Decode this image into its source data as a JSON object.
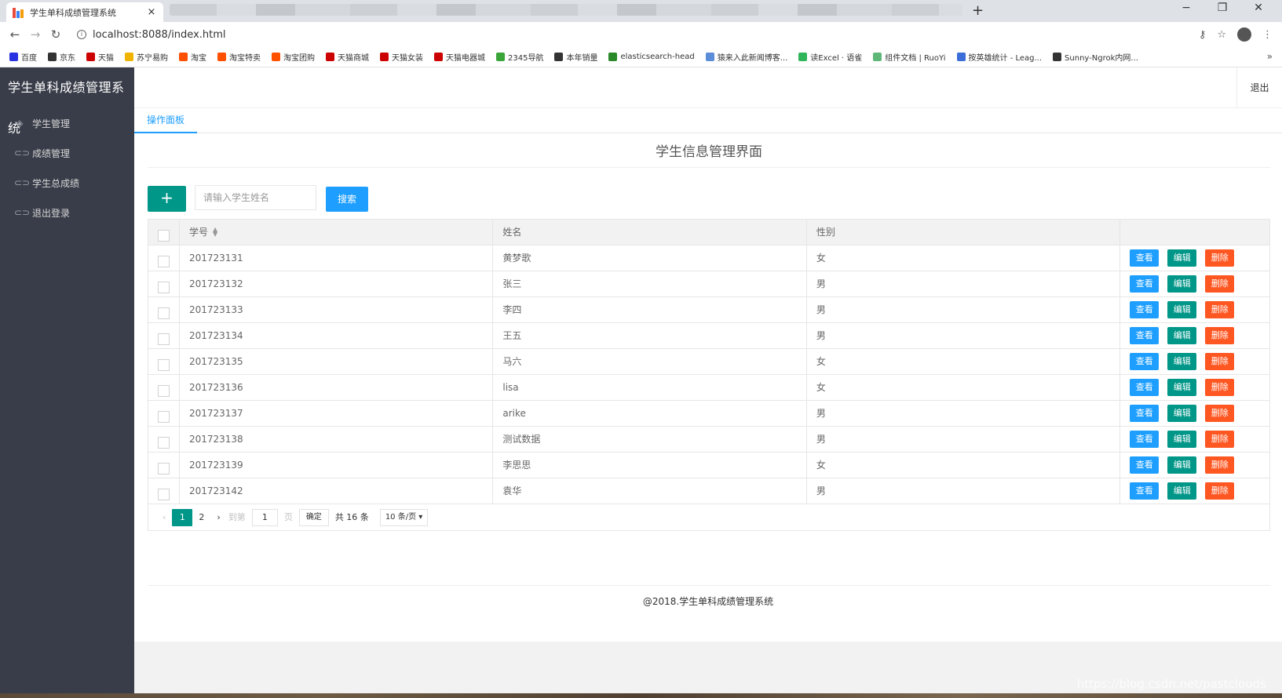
{
  "browser": {
    "tab_title": "学生单科成绩管理系统",
    "tab_close": "×",
    "new_tab": "+",
    "url": "localhost:8088/index.html",
    "window_controls": [
      "−",
      "❐",
      "✕"
    ],
    "bookmarks": [
      {
        "label": "百度",
        "color": "#2932e1"
      },
      {
        "label": "京东",
        "color": "#333333"
      },
      {
        "label": "天猫",
        "color": "#cc0000"
      },
      {
        "label": "苏宁易购",
        "color": "#f0b400"
      },
      {
        "label": "淘宝",
        "color": "#ff5000"
      },
      {
        "label": "淘宝特卖",
        "color": "#ff5000"
      },
      {
        "label": "淘宝团购",
        "color": "#ff5000"
      },
      {
        "label": "天猫商城",
        "color": "#cc0000"
      },
      {
        "label": "天猫女装",
        "color": "#cc0000"
      },
      {
        "label": "天猫电器城",
        "color": "#cc0000"
      },
      {
        "label": "2345导航",
        "color": "#3aa63a"
      },
      {
        "label": "本年销量",
        "color": "#333333"
      },
      {
        "label": "elasticsearch-head",
        "color": "#2a8a2a"
      },
      {
        "label": "猿来入此新闻博客...",
        "color": "#5b8dd9"
      },
      {
        "label": "读Excel · 语雀",
        "color": "#31b55b"
      },
      {
        "label": "组件文档 | RuoYi",
        "color": "#5fb878"
      },
      {
        "label": "按英雄统计 - Leag...",
        "color": "#3b6ed8"
      },
      {
        "label": "Sunny-Ngrok内网...",
        "color": "#333333"
      }
    ],
    "bookmarks_more": "»"
  },
  "app": {
    "title": "学生单科成绩管理系统",
    "logout_top": "退出",
    "menu": [
      {
        "label": "学生管理",
        "icon": "layers-icon"
      },
      {
        "label": "成绩管理",
        "icon": "link-icon"
      },
      {
        "label": "学生总成绩",
        "icon": "link-icon"
      },
      {
        "label": "退出登录",
        "icon": "link-icon"
      }
    ],
    "active_tab": "操作面板",
    "heading": "学生信息管理界面",
    "add_label": "+",
    "search_placeholder": "请输入学生姓名",
    "search_label": "搜索",
    "table": {
      "columns": [
        "学号",
        "姓名",
        "性别",
        ""
      ],
      "action_labels": {
        "view": "查看",
        "edit": "编辑",
        "delete": "删除"
      },
      "rows": [
        {
          "id": "201723131",
          "name": "黄梦歌",
          "sex": "女"
        },
        {
          "id": "201723132",
          "name": "张三",
          "sex": "男"
        },
        {
          "id": "201723133",
          "name": "李四",
          "sex": "男"
        },
        {
          "id": "201723134",
          "name": "王五",
          "sex": "男"
        },
        {
          "id": "201723135",
          "name": "马六",
          "sex": "女"
        },
        {
          "id": "201723136",
          "name": "lisa",
          "sex": "女"
        },
        {
          "id": "201723137",
          "name": "arike",
          "sex": "男"
        },
        {
          "id": "201723138",
          "name": "测试数据",
          "sex": "男"
        },
        {
          "id": "201723139",
          "name": "李思思",
          "sex": "女"
        },
        {
          "id": "201723142",
          "name": "袁华",
          "sex": "男"
        }
      ]
    },
    "pager": {
      "prev": "‹",
      "pages": [
        "1",
        "2"
      ],
      "current": "1",
      "next": "›",
      "goto_label": "到第",
      "goto_value": "1",
      "page_unit": "页",
      "confirm": "确定",
      "total": "共 16 条",
      "page_size": "10 条/页"
    },
    "footer": "@2018.学生单科成绩管理系统"
  },
  "watermark": "https://blog.csdn.net/pastclouds"
}
